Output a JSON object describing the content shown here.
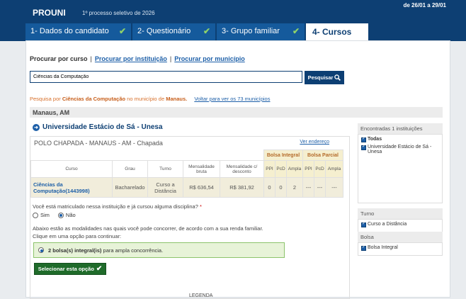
{
  "header": {
    "brand": "PROUNI",
    "subtitle": "1º processo seletivo de 2026",
    "period": "de 26/01 a 29/01"
  },
  "tabs": [
    {
      "label": "1- Dados do candidato",
      "done": true
    },
    {
      "label": "2- Questionário",
      "done": true
    },
    {
      "label": "3- Grupo familiar",
      "done": true
    },
    {
      "label": "4- Cursos",
      "done": false,
      "active": true
    }
  ],
  "search": {
    "current": "Procurar por curso",
    "link_instituicao": "Procurar por instituição",
    "link_municipio": "Procurar por município",
    "value": "Ciências da Computação",
    "button": "Pesquisar"
  },
  "result": {
    "prefix": "Pesquisa por",
    "course": "Ciências da Computação",
    "middle": "no município de",
    "city": "Manaus.",
    "back": "Voltar para ver os 73 municípios"
  },
  "city_bar": "Manaus, AM",
  "institution": {
    "name": "Universidade Estácio de Sá - Unesa",
    "polo": "POLO CHAPADA - MANAUS - AM - Chapada",
    "ver_endereco": "Ver endereço"
  },
  "table": {
    "bolsa_integral": "Bolsa Integral",
    "bolsa_parcial": "Bolsa Parcial",
    "headers": [
      "Curso",
      "Grau",
      "Turno",
      "Mensalidade bruta",
      "Mensalidade c/ desconto"
    ],
    "sub_headers": [
      "PPI",
      "PcD",
      "Ampla",
      "PPI",
      "PcD",
      "Ampla"
    ],
    "row": {
      "curso": "Ciências da Computação(1443998)",
      "grau": "Bacharelado",
      "turno": "Curso a Distância",
      "bruta": "R$ 636,54",
      "desconto": "R$ 381,92",
      "integral": [
        "0",
        "0",
        "2"
      ],
      "parcial": [
        "---",
        "---",
        "---"
      ]
    }
  },
  "question": {
    "text": "Você está matriculado nessa instituição e já cursou alguma disciplina?",
    "required": "*",
    "yes": "Sim",
    "no": "Não",
    "selected": "Não"
  },
  "info": {
    "line1": "Abaixo estão as modalidades nas quais você pode concorrer, de acordo com a sua renda familiar.",
    "line2": "Clique em uma opção para continuar:"
  },
  "option": {
    "bold": "2 bolsa(s) integral(is)",
    "rest": "para ampla concorrência."
  },
  "select_button": "Selecionar esta opção",
  "legenda": "LEGENDA",
  "sidebar": {
    "found": "Encontradas 1 instituições",
    "inst_items": [
      "Todas",
      "Universidade Estácio de Sá - Unesa"
    ],
    "turno_title": "Turno",
    "turno_items": [
      "Curso a Distância"
    ],
    "bolsa_title": "Bolsa",
    "bolsa_items": [
      "Bolsa Integral"
    ]
  },
  "colors": {
    "primary": "#0d3f73",
    "tab": "#155a9c",
    "link": "#1d5fa8",
    "accent_orange": "#d76f2a",
    "success": "#1f6b2a"
  }
}
